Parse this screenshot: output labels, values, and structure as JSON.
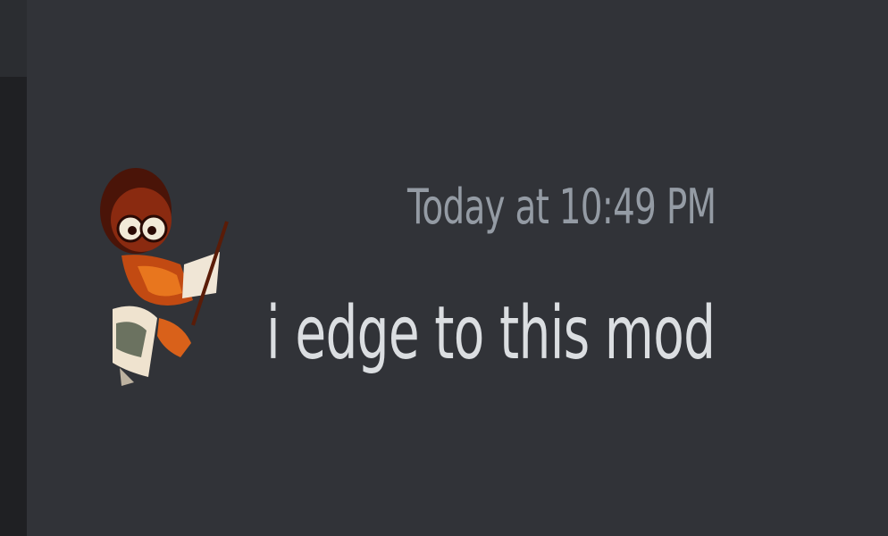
{
  "message": {
    "timestamp": "Today at 10:49 PM",
    "content": "i edge to this mod",
    "avatar_icon": "cartoon-character-avatar"
  },
  "colors": {
    "background": "#313338",
    "rail_top": "#2b2d31",
    "rail_bottom": "#1f2023",
    "timestamp": "#949ba4",
    "text": "#dbdee1"
  }
}
